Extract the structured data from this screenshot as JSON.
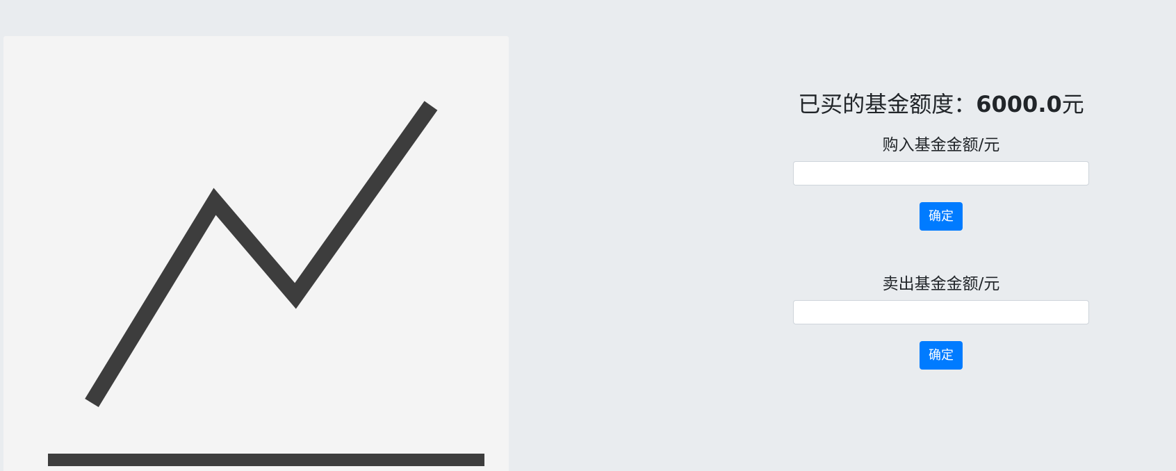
{
  "hero": {
    "icon": "line-chart-icon",
    "line_color": "#3d3d3d",
    "background": "#f4f4f4"
  },
  "fund": {
    "balance_label": "已买的基金额度：",
    "balance_amount": "6000.0",
    "balance_unit": "元"
  },
  "buy": {
    "label": "购入基金金额/元",
    "value": "",
    "placeholder": "",
    "confirm_label": "确定"
  },
  "sell": {
    "label": "卖出基金金额/元",
    "value": "",
    "placeholder": "",
    "confirm_label": "确定"
  },
  "colors": {
    "page_background": "#e9ecef",
    "primary_button": "#007bff",
    "text": "#212529"
  }
}
